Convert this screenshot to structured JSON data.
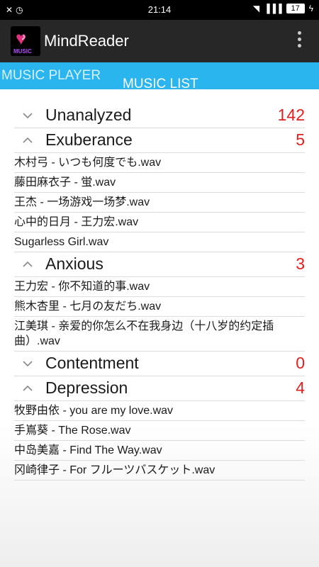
{
  "status_bar": {
    "time": "21:14",
    "battery": "17",
    "left_icons": [
      "mute-icon",
      "alarm-icon"
    ],
    "right_icons": [
      "wifi-icon",
      "signal-icon",
      "battery-icon",
      "charging-icon"
    ]
  },
  "app_bar": {
    "title": "MindReader",
    "icon_text": "MUSIC"
  },
  "tabs": [
    {
      "label": "MUSIC PLAYER"
    },
    {
      "label": "MUSIC LIST"
    }
  ],
  "groups": [
    {
      "name": "Unanalyzed",
      "count": "142",
      "expanded": false,
      "songs": []
    },
    {
      "name": "Exuberance",
      "count": "5",
      "expanded": true,
      "songs": [
        "木村弓 - いつも何度でも.wav",
        "藤田麻衣子 - 蛍.wav",
        "王杰 - 一场游戏一场梦.wav",
        "心中的日月 - 王力宏.wav",
        "Sugarless Girl.wav"
      ]
    },
    {
      "name": "Anxious",
      "count": "3",
      "expanded": true,
      "songs": [
        "王力宏 - 你不知道的事.wav",
        "熊木杏里 - 七月の友だち.wav",
        "江美琪 - 亲爱的你怎么不在我身边（十八岁的约定插曲）.wav"
      ]
    },
    {
      "name": "Contentment",
      "count": "0",
      "expanded": false,
      "songs": []
    },
    {
      "name": "Depression",
      "count": "4",
      "expanded": true,
      "songs": [
        "牧野由依 - you are my love.wav",
        "手嶌葵 - The Rose.wav",
        "中岛美嘉 - Find The Way.wav",
        "冈崎律子 - For フルーツバスケット.wav"
      ]
    }
  ],
  "colors": {
    "status_bar": "#000000",
    "app_bar": "#272727",
    "tab_bar": "#2bb5ee",
    "count": "#e02020"
  }
}
